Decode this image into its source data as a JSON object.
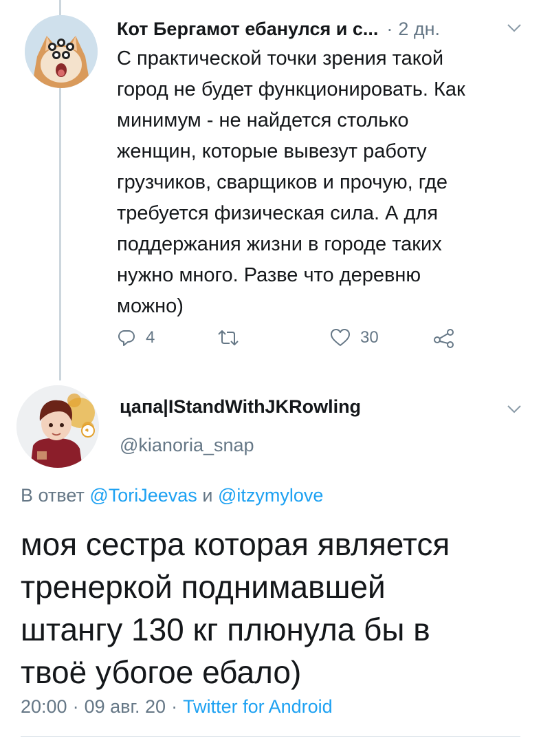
{
  "tweet1": {
    "author_name": "Кот Бергамот ебанулся и с...",
    "separator": "·",
    "time_ago": "2 дн.",
    "text": "С практической точки зрения такой\nгород не будет функционировать. Как\nминимум - не найдется столько\nженщин, которые вывезут работу\nгрузчиков, сварщиков и прочую, где\nтребуется физическая сила. А для\nподдержания жизни в городе таких\nнужно много. Разве что деревню\nможно)",
    "actions": {
      "reply_count": "4",
      "retweet_count": "",
      "like_count": "30"
    },
    "icons": {
      "menu": "chevron-down-icon",
      "reply": "reply-icon",
      "retweet": "retweet-icon",
      "like": "heart-icon",
      "share": "share-icon"
    }
  },
  "tweet2": {
    "author_name": "цапа|IStandWithJKRowling",
    "handle": "@kianoria_snap",
    "reply_prefix": "В ответ",
    "reply_to_1": "@ToriJeevas",
    "reply_conjunction": "и",
    "reply_to_2": "@itzymylove",
    "text": "моя сестра которая является\nтренеркой поднимавшей\nштангу 130 кг плюнула бы в\nтвоё убогое ебало)",
    "meta": {
      "time": "20:00",
      "separator": "·",
      "date": "09 авг. 20",
      "client": "Twitter for Android"
    }
  },
  "colors": {
    "text": "#14171a",
    "secondary": "#657786",
    "link": "#1da1f2",
    "thread_line": "#ccd6dd",
    "divider": "#e1e8ed"
  }
}
